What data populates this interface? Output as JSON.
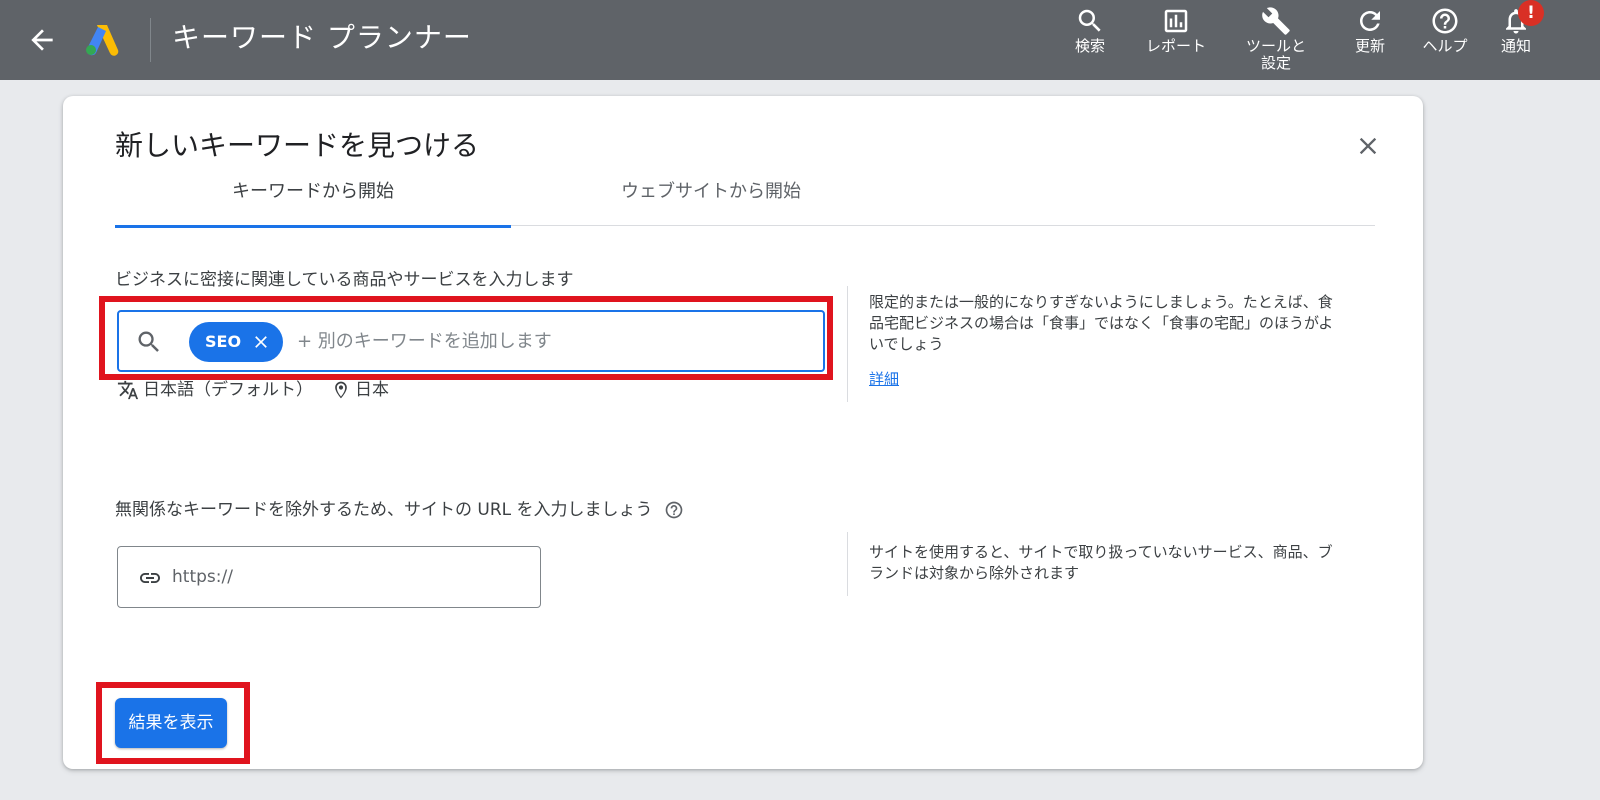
{
  "header": {
    "title": "キーワード プランナー",
    "tools": [
      {
        "label": "検索",
        "icon": "search-icon"
      },
      {
        "label": "レポート",
        "icon": "report-icon"
      },
      {
        "label": "ツールと\n設定",
        "icon": "wrench-icon"
      },
      {
        "label": "更新",
        "icon": "refresh-icon"
      },
      {
        "label": "ヘルプ",
        "icon": "help-icon"
      },
      {
        "label": "通知",
        "icon": "bell-icon"
      }
    ],
    "notification_badge": "!"
  },
  "dialog": {
    "title": "新しいキーワードを見つける",
    "tabs": [
      {
        "label": "キーワードから開始",
        "active": true
      },
      {
        "label": "ウェブサイトから開始",
        "active": false
      }
    ],
    "keyword_section": {
      "label": "ビジネスに密接に関連している商品やサービスを入力します",
      "chip": "SEO",
      "placeholder": "+ 別のキーワードを追加します",
      "language": "日本語（デフォルト）",
      "location": "日本",
      "hint": "限定的または一般的になりすぎないようにしましょう。たとえば、食品宅配ビジネスの場合は「食事」ではなく「食事の宅配」のほうがよいでしょう",
      "hint_link": "詳細"
    },
    "url_section": {
      "label": "無関係なキーワードを除外するため、サイトの URL を入力しましょう",
      "placeholder": "https://",
      "hint": "サイトを使用すると、サイトで取り扱っていないサービス、商品、ブランドは対象から除外されます"
    },
    "submit_label": "結果を表示"
  },
  "colors": {
    "topbar": "#5f6368",
    "accent": "#1a73e8",
    "highlight": "#e0141e",
    "badge": "#d93025"
  }
}
